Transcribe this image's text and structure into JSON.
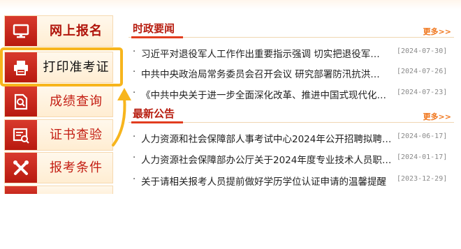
{
  "sidebar": {
    "items": [
      {
        "label": "网上报名",
        "icon": "monitor-icon"
      },
      {
        "label": "打印准考证",
        "icon": "printer-icon"
      },
      {
        "label": "成绩查询",
        "icon": "search-document-icon"
      },
      {
        "label": "证书查验",
        "icon": "certificate-check-icon"
      },
      {
        "label": "报考条件",
        "icon": "tools-icon"
      },
      {
        "label": "",
        "icon": "partial-icon"
      }
    ]
  },
  "highlight_color": "#f7b51d",
  "accent_red": "#b71c0f",
  "more_color": "#f0761c",
  "panels": [
    {
      "title": "时政要闻",
      "more": "更多>>",
      "items": [
        {
          "title": "习近平对退役军人工作作出重要指示强调 切实把退役军…",
          "date": "[2024-07-30]"
        },
        {
          "title": "中共中央政治局常务委员会召开会议 研究部署防汛抗洪…",
          "date": "[2024-07-26]"
        },
        {
          "title": "《中共中央关于进一步全面深化改革、推进中国式现代化…",
          "date": "[2024-07-23]"
        }
      ]
    },
    {
      "title": "最新公告",
      "more": "更多>>",
      "items": [
        {
          "title": "人力资源和社会保障部人事考试中心2024年公开招聘拟聘…",
          "date": "[2024-06-17]"
        },
        {
          "title": "人力资源社会保障部办公厅关于2024年度专业技术人员职…",
          "date": "[2024-01-17]"
        },
        {
          "title": "关于请相关报考人员提前做好学历学位认证申请的温馨提醒",
          "date": "[2023-12-29]"
        }
      ]
    }
  ]
}
